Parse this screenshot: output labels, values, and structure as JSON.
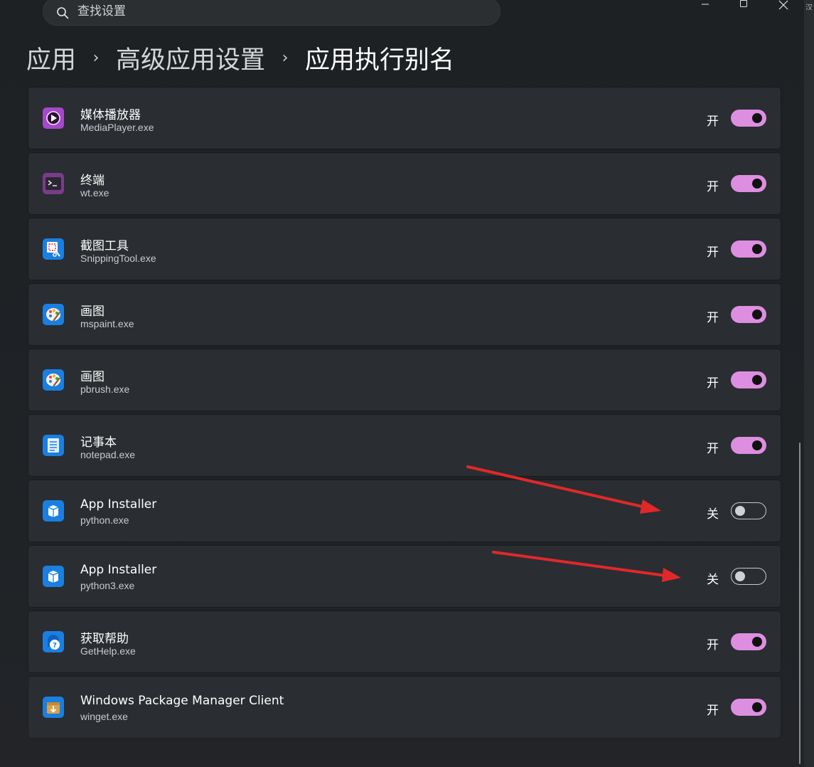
{
  "search": {
    "placeholder": "查找设置"
  },
  "breadcrumb": {
    "items": [
      "应用",
      "高级应用设置",
      "应用执行别名"
    ],
    "separator": "›"
  },
  "window_controls": {
    "minimize": "minimize-icon",
    "maximize": "maximize-icon",
    "close": "close-icon"
  },
  "edge_fragment": "汉",
  "colors": {
    "background": "#1f2326",
    "card": "#2a2d31",
    "toggle_on": "#dd8ee0",
    "annotation_arrow": "#e0282a"
  },
  "aliases": [
    {
      "name": "媒体播放器",
      "exe": "MediaPlayer.exe",
      "state": "开",
      "on": true,
      "icon": "media-player-icon"
    },
    {
      "name": "终端",
      "exe": "wt.exe",
      "state": "开",
      "on": true,
      "icon": "terminal-icon"
    },
    {
      "name": "截图工具",
      "exe": "SnippingTool.exe",
      "state": "开",
      "on": true,
      "icon": "snipping-tool-icon"
    },
    {
      "name": "画图",
      "exe": "mspaint.exe",
      "state": "开",
      "on": true,
      "icon": "paint-icon"
    },
    {
      "name": "画图",
      "exe": "pbrush.exe",
      "state": "开",
      "on": true,
      "icon": "paint-icon"
    },
    {
      "name": "记事本",
      "exe": "notepad.exe",
      "state": "开",
      "on": true,
      "icon": "notepad-icon"
    },
    {
      "name": "App Installer",
      "exe": "python.exe",
      "state": "关",
      "on": false,
      "icon": "app-installer-icon"
    },
    {
      "name": "App Installer",
      "exe": "python3.exe",
      "state": "关",
      "on": false,
      "icon": "app-installer-icon"
    },
    {
      "name": "获取帮助",
      "exe": "GetHelp.exe",
      "state": "开",
      "on": true,
      "icon": "get-help-icon"
    },
    {
      "name": "Windows Package Manager Client",
      "exe": "winget.exe",
      "state": "开",
      "on": true,
      "icon": "package-manager-icon"
    }
  ]
}
